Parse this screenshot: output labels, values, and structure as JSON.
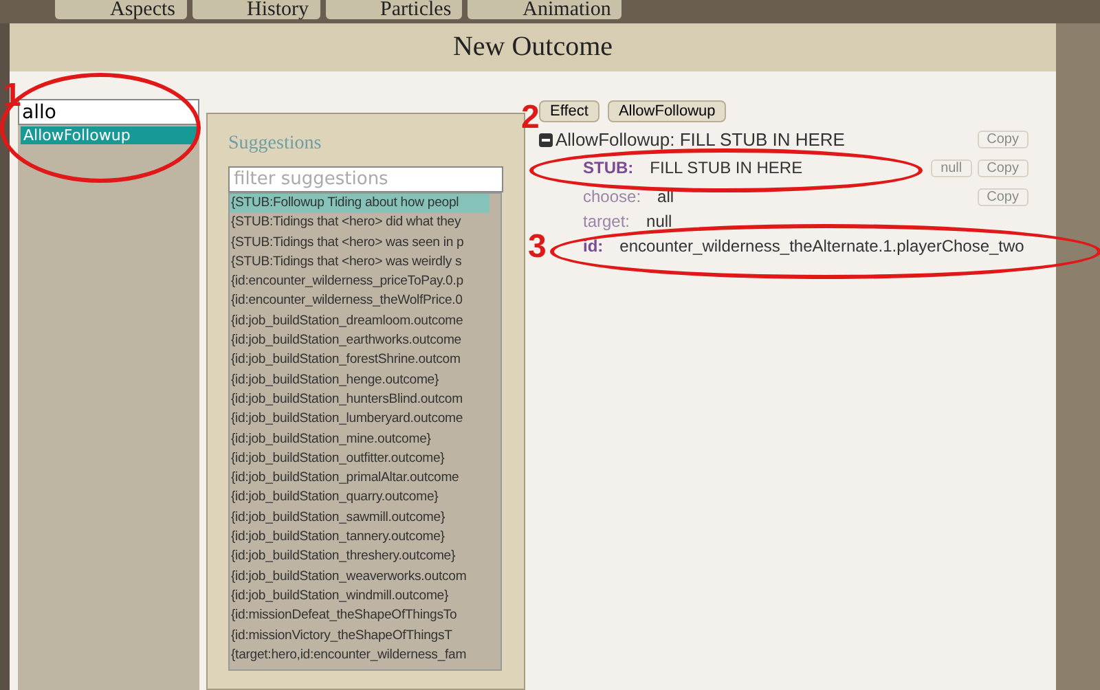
{
  "top_tabs": [
    {
      "label": "Aspects"
    },
    {
      "label": "History"
    },
    {
      "label": "Particles"
    },
    {
      "label": "Animation"
    }
  ],
  "dialog": {
    "title": "New Outcome"
  },
  "type_search": {
    "value": "allo",
    "results": [
      {
        "label": "AllowFollowup",
        "selected": true
      }
    ]
  },
  "suggestions": {
    "heading": "Suggestions",
    "filter_placeholder": "filter suggestions",
    "items": [
      {
        "text": "{STUB:Followup Tiding about how peopl",
        "selected": true
      },
      {
        "text": "{STUB:Tidings that <hero> did what they",
        "selected": false
      },
      {
        "text": "{STUB:Tidings that <hero> was seen in p",
        "selected": false
      },
      {
        "text": "{STUB:Tidings that <hero> was weirdly s",
        "selected": false
      },
      {
        "text": "{id:encounter_wilderness_priceToPay.0.p",
        "selected": false
      },
      {
        "text": "{id:encounter_wilderness_theWolfPrice.0",
        "selected": false
      },
      {
        "text": "{id:job_buildStation_dreamloom.outcome",
        "selected": false
      },
      {
        "text": "{id:job_buildStation_earthworks.outcome",
        "selected": false
      },
      {
        "text": "{id:job_buildStation_forestShrine.outcom",
        "selected": false
      },
      {
        "text": "{id:job_buildStation_henge.outcome}",
        "selected": false
      },
      {
        "text": "{id:job_buildStation_huntersBlind.outcom",
        "selected": false
      },
      {
        "text": "{id:job_buildStation_lumberyard.outcome",
        "selected": false
      },
      {
        "text": "{id:job_buildStation_mine.outcome}",
        "selected": false
      },
      {
        "text": "{id:job_buildStation_outfitter.outcome}",
        "selected": false
      },
      {
        "text": "{id:job_buildStation_primalAltar.outcome",
        "selected": false
      },
      {
        "text": "{id:job_buildStation_quarry.outcome}",
        "selected": false
      },
      {
        "text": "{id:job_buildStation_sawmill.outcome}",
        "selected": false
      },
      {
        "text": "{id:job_buildStation_tannery.outcome}",
        "selected": false
      },
      {
        "text": "{id:job_buildStation_threshery.outcome}",
        "selected": false
      },
      {
        "text": "{id:job_buildStation_weaverworks.outcom",
        "selected": false
      },
      {
        "text": "{id:job_buildStation_windmill.outcome}",
        "selected": false
      },
      {
        "text": "{id:missionDefeat_theShapeOfThingsTo",
        "selected": false
      },
      {
        "text": "{id:missionVictory_theShapeOfThingsT",
        "selected": false
      },
      {
        "text": "{target:hero,id:encounter_wilderness_fam",
        "selected": false
      }
    ]
  },
  "breadcrumbs": [
    "Effect",
    "AllowFollowup"
  ],
  "tree": {
    "label": "AllowFollowup: FILL STUB IN HERE",
    "expanded": true,
    "copy": "Copy",
    "fields": [
      {
        "key": "STUB:",
        "value": "FILL STUB IN HERE",
        "emphasis": true,
        "null_button": "null",
        "copy": "Copy"
      },
      {
        "key": "choose:",
        "value": "all",
        "emphasis": false,
        "copy": "Copy"
      },
      {
        "key": "target:",
        "value": "null",
        "emphasis": false
      },
      {
        "key": "id:",
        "value": "encounter_wilderness_theAlternate.1.playerChose_two",
        "emphasis": true
      }
    ]
  },
  "annotations": [
    {
      "number": "1"
    },
    {
      "number": "2"
    },
    {
      "number": "3"
    }
  ]
}
